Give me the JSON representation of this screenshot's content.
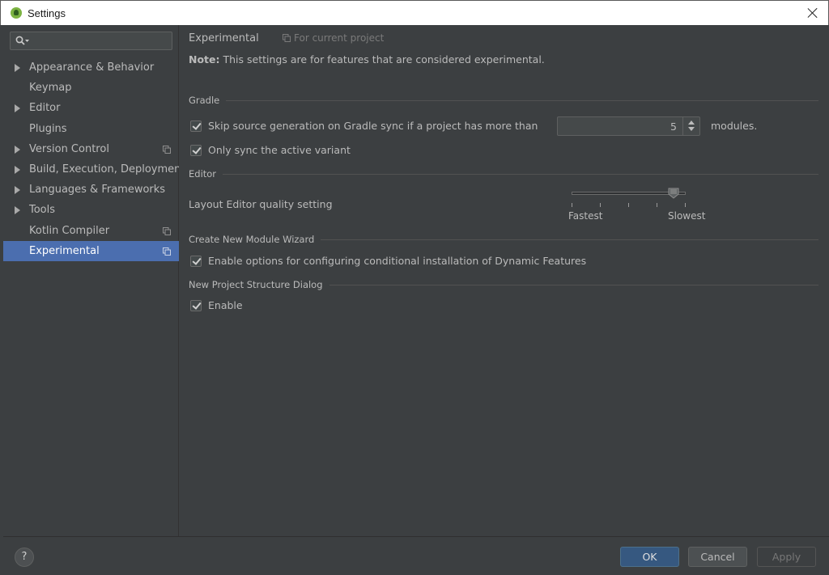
{
  "window": {
    "title": "Settings"
  },
  "sidebar": {
    "search": {
      "placeholder": ""
    },
    "items": [
      {
        "label": "Appearance & Behavior",
        "expandable": true,
        "project_scope": false,
        "selected": false
      },
      {
        "label": "Keymap",
        "expandable": false,
        "project_scope": false,
        "selected": false
      },
      {
        "label": "Editor",
        "expandable": true,
        "project_scope": false,
        "selected": false
      },
      {
        "label": "Plugins",
        "expandable": false,
        "project_scope": false,
        "selected": false
      },
      {
        "label": "Version Control",
        "expandable": true,
        "project_scope": true,
        "selected": false
      },
      {
        "label": "Build, Execution, Deployment",
        "expandable": true,
        "project_scope": false,
        "selected": false
      },
      {
        "label": "Languages & Frameworks",
        "expandable": true,
        "project_scope": false,
        "selected": false
      },
      {
        "label": "Tools",
        "expandable": true,
        "project_scope": false,
        "selected": false
      },
      {
        "label": "Kotlin Compiler",
        "expandable": false,
        "project_scope": true,
        "selected": false
      },
      {
        "label": "Experimental",
        "expandable": false,
        "project_scope": true,
        "selected": true
      }
    ]
  },
  "main": {
    "title": "Experimental",
    "scope_label": "For current project",
    "note_prefix": "Note:",
    "note_text": " This settings are for features that are considered ",
    "note_emphasis": "experimental",
    "note_suffix": ".",
    "sections": {
      "gradle": {
        "title": "Gradle",
        "skip_source_label": "Skip source generation on Gradle sync if a project has more than",
        "skip_source_checked": true,
        "module_count": "5",
        "modules_suffix": "modules.",
        "only_sync_label": "Only sync the active variant",
        "only_sync_checked": true
      },
      "editor": {
        "title": "Editor",
        "layout_quality_label": "Layout Editor quality setting",
        "slider_min_label": "Fastest",
        "slider_max_label": "Slowest",
        "slider_position": 0.9,
        "slider_ticks": 5
      },
      "module_wizard": {
        "title": "Create New Module Wizard",
        "dynamic_features_label": "Enable options for configuring conditional installation of Dynamic Features",
        "dynamic_features_checked": true
      },
      "project_structure": {
        "title": "New Project Structure Dialog",
        "enable_label": "Enable",
        "enable_checked": true
      }
    }
  },
  "footer": {
    "help_label": "?",
    "ok_label": "OK",
    "cancel_label": "Cancel",
    "apply_label": "Apply"
  },
  "colors": {
    "selection": "#4b6eaf",
    "panel": "#3c3f41",
    "ok_button": "#365880"
  }
}
